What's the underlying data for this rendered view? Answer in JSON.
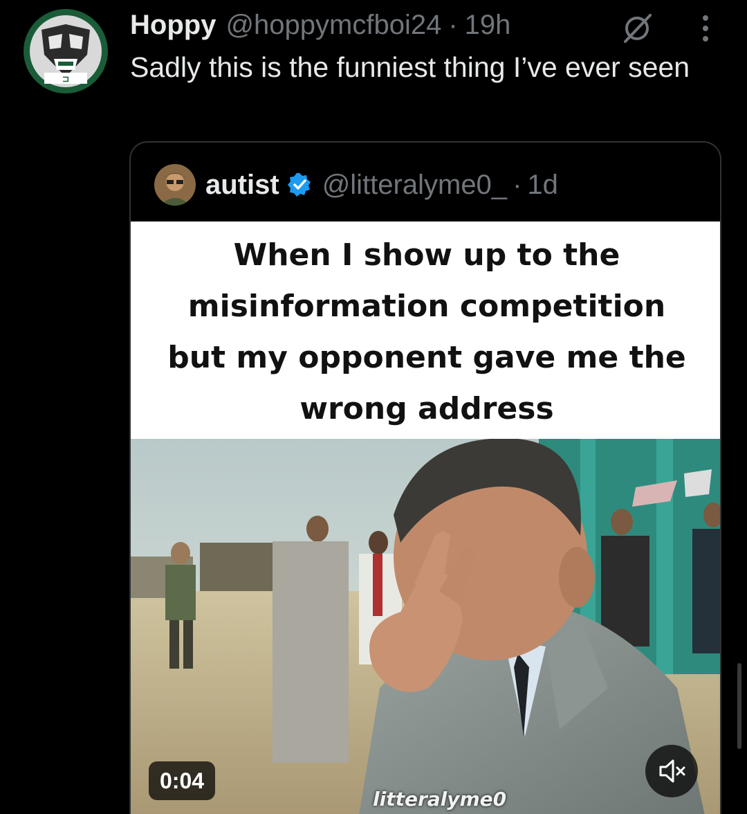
{
  "post": {
    "author_name": "Hoppy",
    "author_handle": "@hoppymcfboi24",
    "separator": "·",
    "time": "19h",
    "text": "Sadly this is the funniest thing I’ve ever seen",
    "avatar_icon": "mask-avatar"
  },
  "quoted": {
    "author_name": "autist",
    "verified": true,
    "author_handle": "@litteralyme0_",
    "separator": "·",
    "time": "1d",
    "caption": "When I show up to the misinformation competition but my opponent gave me the wrong address",
    "video_duration": "0:04",
    "watermark": "litteralyme0",
    "muted": true
  },
  "icons": [
    "grok-icon",
    "more-icon",
    "verified-icon",
    "mute-icon"
  ],
  "colors": {
    "background": "#000000",
    "text": "#e7e9ea",
    "secondary": "#71767b",
    "verified": "#1d9bf0",
    "border": "#2f3336"
  }
}
